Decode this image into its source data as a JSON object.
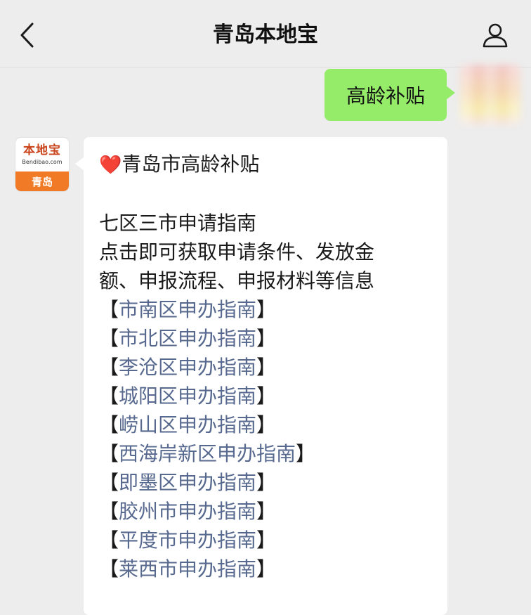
{
  "header": {
    "title": "青岛本地宝",
    "back_icon": "chevron-left-icon",
    "profile_icon": "person-icon"
  },
  "sent_message": {
    "text": "高龄补贴"
  },
  "account_avatar": {
    "brand": "本地宝",
    "domain": "Bendibao.com",
    "city": "青岛"
  },
  "reply": {
    "heart": "❤️",
    "headline": "青岛市高龄补贴",
    "intro_title": "七区三市申请指南",
    "intro_line1": "点击即可获取申请条件、发放金",
    "intro_line2": "额、申报流程、申报材料等信息",
    "bracket_open": "【",
    "bracket_close": "】",
    "links": [
      "市南区申办指南",
      "市北区申办指南",
      "李沧区申办指南",
      "城阳区申办指南",
      "崂山区申办指南",
      "西海岸新区申办指南",
      "即墨区申办指南",
      "胶州市申办指南",
      "平度市申办指南",
      "莱西市申办指南"
    ]
  },
  "colors": {
    "background": "#ededed",
    "sent_bubble": "#95ec69",
    "reply_bubble": "#ffffff",
    "link": "#57698f",
    "brand_orange": "#f07a25"
  }
}
